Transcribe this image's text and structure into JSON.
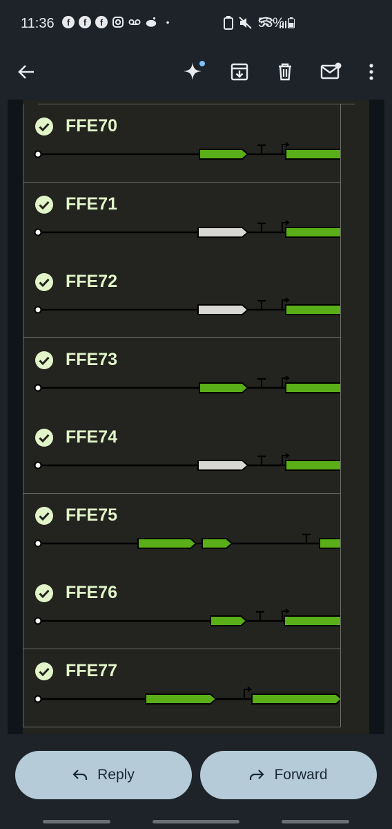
{
  "status_bar": {
    "time": "11:36",
    "battery": "53%"
  },
  "toolbar": {
    "back_icon": "arrow-back-icon",
    "gemini_icon": "sparkle-icon",
    "archive_icon": "archive-icon",
    "delete_icon": "trash-icon",
    "unread_icon": "mail-unread-icon",
    "more_icon": "more-vert-icon"
  },
  "rows": [
    {
      "name": "FFE70"
    },
    {
      "name": "FFE71"
    },
    {
      "name": "FFE72"
    },
    {
      "name": "FFE73"
    },
    {
      "name": "FFE74"
    },
    {
      "name": "FFE75"
    },
    {
      "name": "FFE76"
    },
    {
      "name": "FFE77"
    }
  ],
  "actions": {
    "reply_label": "Reply",
    "forward_label": "Forward"
  },
  "colors": {
    "gene_green": "#5aae18",
    "gene_white": "#d9d7d3",
    "title_green": "#e1f5c9",
    "pill": "#b5cbd8"
  }
}
